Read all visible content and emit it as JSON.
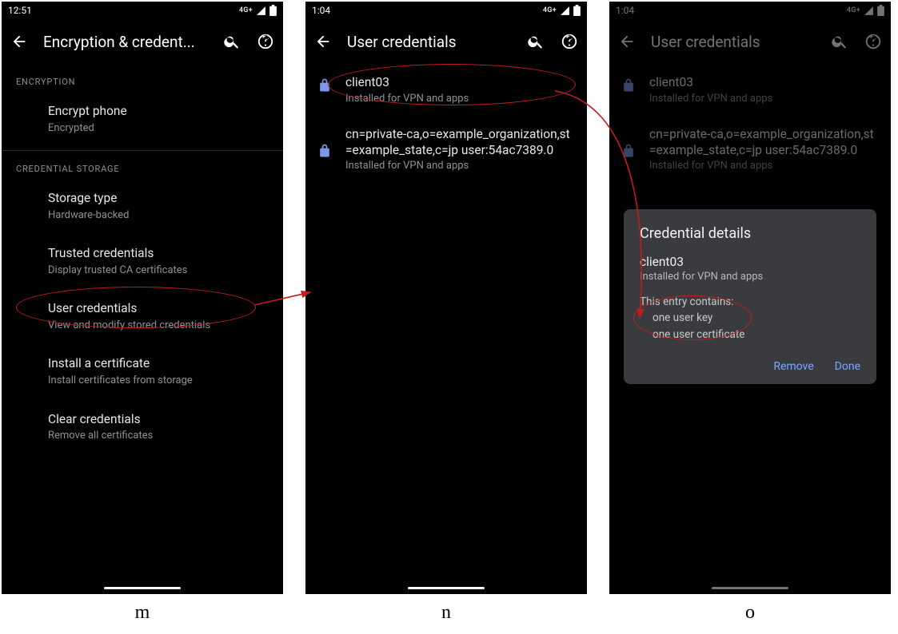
{
  "captions": {
    "m": "m",
    "n": "n",
    "o": "o"
  },
  "screen_m": {
    "statusbar": {
      "time": "12:51",
      "network": "4G+"
    },
    "appbar": {
      "title": "Encryption & credent..."
    },
    "sections": {
      "encryption": {
        "label": "ENCRYPTION",
        "items": [
          {
            "title": "Encrypt phone",
            "subtitle": "Encrypted"
          }
        ]
      },
      "credential_storage": {
        "label": "CREDENTIAL STORAGE",
        "items": [
          {
            "title": "Storage type",
            "subtitle": "Hardware-backed"
          },
          {
            "title": "Trusted credentials",
            "subtitle": "Display trusted CA certificates"
          },
          {
            "title": "User credentials",
            "subtitle": "View and modify stored credentials"
          },
          {
            "title": "Install a certificate",
            "subtitle": "Install certificates from storage"
          },
          {
            "title": "Clear credentials",
            "subtitle": "Remove all certificates"
          }
        ]
      }
    }
  },
  "screen_n": {
    "statusbar": {
      "time": "1:04",
      "network": "4G+"
    },
    "appbar": {
      "title": "User credentials"
    },
    "credentials": [
      {
        "title": "client03",
        "subtitle": "Installed for VPN and apps"
      },
      {
        "title": "cn=private-ca,o=example_organization,st=example_state,c=jp user:54ac7389.0",
        "subtitle": "Installed for VPN and apps"
      }
    ]
  },
  "screen_o": {
    "statusbar": {
      "time": "1:04",
      "network": "4G+"
    },
    "appbar": {
      "title": "User credentials"
    },
    "credentials": [
      {
        "title": "client03",
        "subtitle": "Installed for VPN and apps"
      },
      {
        "title": "cn=private-ca,o=example_organization,st=example_state,c=jp user:54ac7389.0",
        "subtitle": "Installed for VPN and apps"
      }
    ],
    "dialog": {
      "heading": "Credential details",
      "name": "client03",
      "subtitle": "Installed for VPN and apps",
      "body_intro": "This entry contains:",
      "body_lines": [
        "one user key",
        "one user certificate"
      ],
      "remove": "Remove",
      "done": "Done"
    }
  }
}
